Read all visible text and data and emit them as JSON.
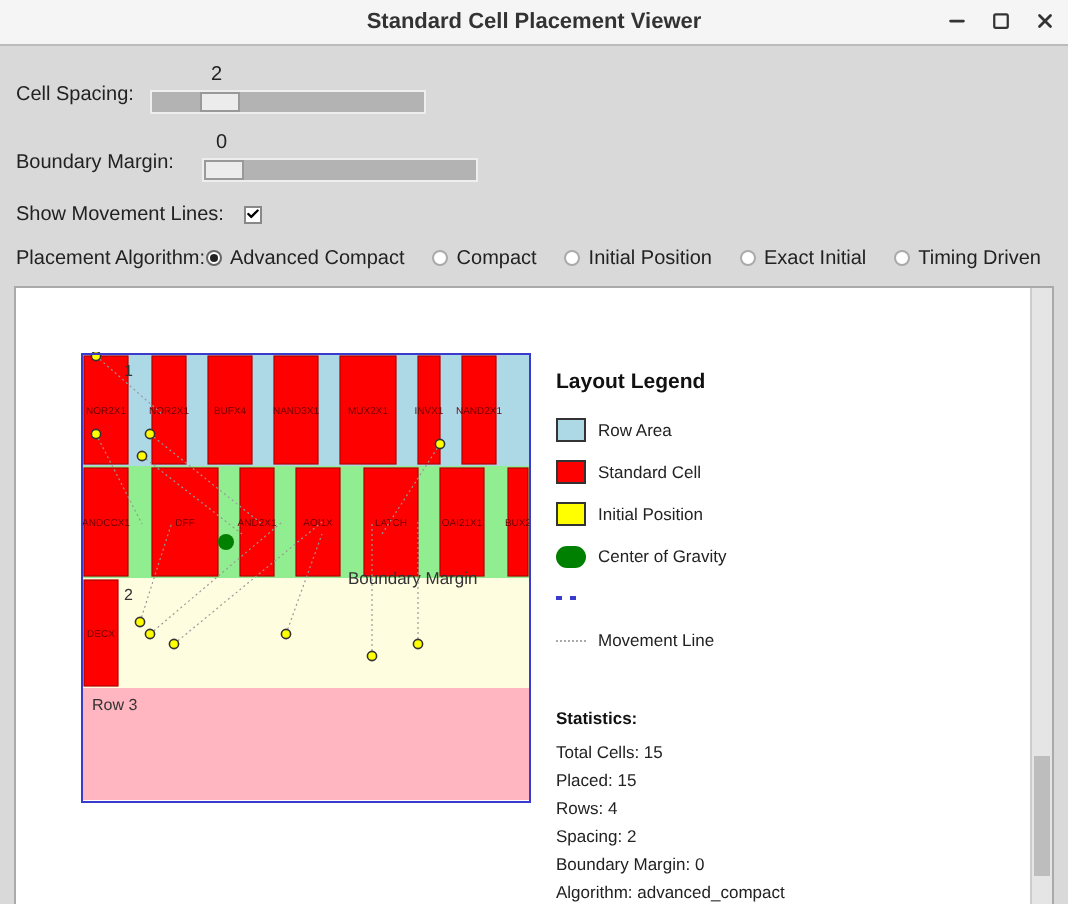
{
  "window": {
    "title": "Standard Cell Placement Viewer"
  },
  "sliders": [
    {
      "label": "Cell Spacing:",
      "value": "2",
      "level": 0.2
    },
    {
      "label": "Boundary Margin:",
      "value": "0",
      "level": 0
    }
  ],
  "movement_lines": {
    "label": "Show Movement Lines:",
    "checked": true
  },
  "algorithm": {
    "label": "Placement Algorithm:",
    "options": [
      {
        "label": "Advanced Compact",
        "selected": true
      },
      {
        "label": "Compact",
        "selected": false
      },
      {
        "label": "Initial Position",
        "selected": false
      },
      {
        "label": "Exact Initial",
        "selected": false
      },
      {
        "label": "Timing Driven",
        "selected": false
      }
    ]
  },
  "layout": {
    "placement_rows": [
      {
        "label": "1",
        "placed_cells": [
          "NOR2X1",
          "NOR2X1",
          "BUFX4",
          "NAND3X1",
          "MUX2X1",
          "INVX1",
          "NAND2X1"
        ]
      },
      {
        "placed_cells": [
          "ANDCCX1",
          "DFF",
          "AND2X1",
          "AOI1X",
          "LATCH",
          "OAI21X1",
          "BUX2"
        ]
      },
      {
        "label": "2",
        "placed_cells": [
          "DECX"
        ]
      },
      {
        "label": "Row 3"
      }
    ],
    "boundary_label": "Boundary Margin"
  },
  "legend": {
    "title": "Layout Legend",
    "items": [
      {
        "kind": "rect",
        "color": "#add8e6",
        "label": "Row Area"
      },
      {
        "kind": "rect",
        "color": "#ff0000",
        "label": "Standard Cell"
      },
      {
        "kind": "rect",
        "color": "#ffff00",
        "label": "Initial Position"
      },
      {
        "kind": "circle",
        "color": "#008000",
        "label": "Center of Gravity"
      },
      {
        "kind": "dash",
        "color": "#3a3acc"
      },
      {
        "kind": "dotted",
        "label": "Movement Line"
      }
    ]
  },
  "statistics": {
    "title": "Statistics:",
    "lines": [
      "Total Cells: 15",
      "Placed: 15",
      "Rows: 4",
      "Spacing: 2",
      "Boundary Margin: 0",
      "Algorithm: advanced_compact"
    ]
  }
}
